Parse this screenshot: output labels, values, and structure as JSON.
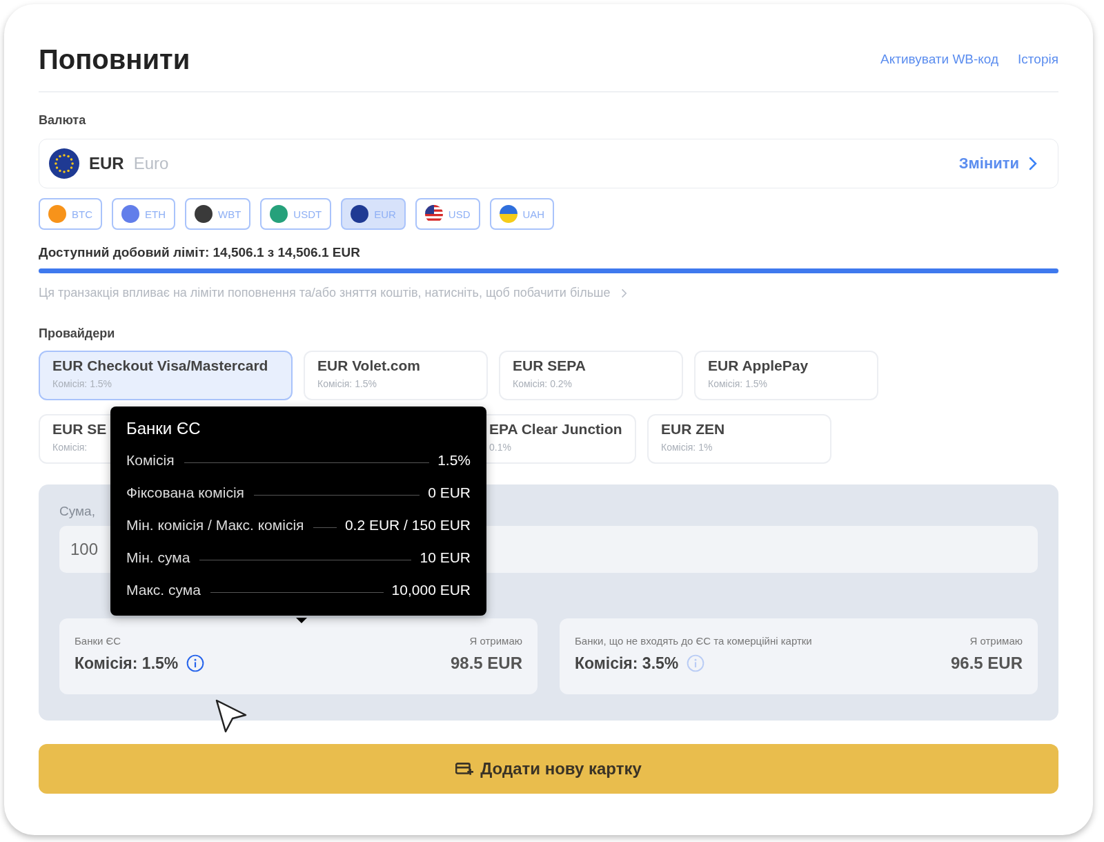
{
  "header": {
    "title": "Поповнити",
    "links": [
      "Активувати WB-код",
      "Історія"
    ]
  },
  "currency": {
    "label": "Валюта",
    "code": "EUR",
    "name": "Euro",
    "action": "Змінити"
  },
  "chips": [
    {
      "label": "BTC",
      "kind": "coin",
      "color": "#f7931a",
      "selected": false
    },
    {
      "label": "ETH",
      "kind": "coin",
      "color": "#627eea",
      "selected": false
    },
    {
      "label": "WBT",
      "kind": "coin",
      "color": "#3a3a3a",
      "selected": false
    },
    {
      "label": "USDT",
      "kind": "coin",
      "color": "#26a17b",
      "selected": false
    },
    {
      "label": "EUR",
      "kind": "coin",
      "color": "#1f3a93",
      "selected": true
    },
    {
      "label": "USD",
      "kind": "flag-us",
      "selected": false
    },
    {
      "label": "UAH",
      "kind": "flag-ua",
      "selected": false
    }
  ],
  "limit": {
    "text": "Доступний добовий ліміт: 14,506.1 з 14,506.1 EUR",
    "level": 1,
    "note": "Ця транзакція впливає на ліміти поповнення та/або зняття коштів, натисніть, щоб побачити більше"
  },
  "providers": {
    "label": "Провайдери",
    "items": [
      {
        "title": "EUR Checkout Visa/Mastercard",
        "fee": "Комісія: 1.5%",
        "selected": true,
        "kind": "wide"
      },
      {
        "title": "EUR Volet.com",
        "fee": "Комісія: 1.5%",
        "selected": false,
        "kind": "full"
      },
      {
        "title": "EUR SEPA",
        "fee": "Комісія: 0.2%",
        "selected": false,
        "kind": "full"
      },
      {
        "title": "EUR ApplePay",
        "fee": "Комісія: 1.5%",
        "selected": false,
        "kind": "full"
      },
      {
        "title": "EUR SE",
        "fee": "Комісія:",
        "selected": false,
        "kind": "covered-right"
      },
      {
        "title": "EPA Clear Junction",
        "fee": "0.1%",
        "selected": false,
        "kind": "covered-left"
      },
      {
        "title": "EUR ZEN",
        "fee": "Комісія: 1%",
        "selected": false,
        "kind": "full"
      }
    ]
  },
  "amount": {
    "label": "Сума,",
    "value": "100"
  },
  "results": [
    {
      "group": "Банки ЄС",
      "receive_label": "Я отримаю",
      "fee": "Комісія: 1.5%",
      "receive": "98.5 EUR",
      "active": true
    },
    {
      "group": "Банки, що не входять до ЄС та комерційні картки",
      "receive_label": "Я отримаю",
      "fee": "Комісія: 3.5%",
      "receive": "96.5 EUR",
      "active": false
    }
  ],
  "tooltip": {
    "title": "Банки ЄС",
    "rows": [
      {
        "label": "Комісія",
        "value": "1.5%"
      },
      {
        "label": "Фіксована комісія",
        "value": "0 EUR"
      },
      {
        "label": "Мін. комісія / Макс. комісія",
        "value": "0.2 EUR / 150 EUR"
      },
      {
        "label": "Мін. сума",
        "value": "10 EUR"
      },
      {
        "label": "Макс. сума",
        "value": "10,000 EUR"
      }
    ]
  },
  "button": {
    "label": "Додати нову картку"
  }
}
